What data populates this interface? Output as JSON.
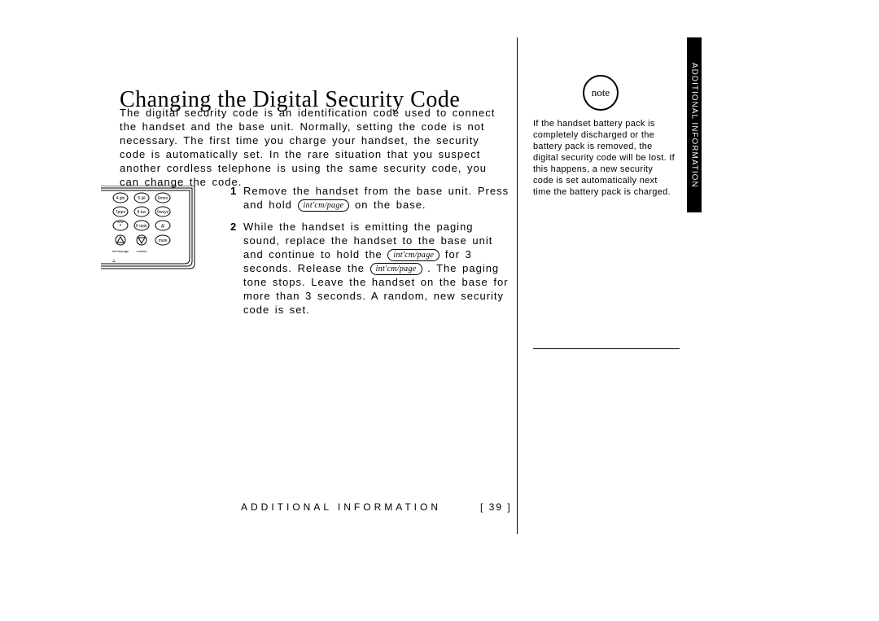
{
  "title": "Changing the Digital Security Code",
  "intro": "The digital security code is an identification code used to connect the handset and the base unit. Normally, setting the code is not necessary. The first time you charge your handset, the security code is automatically set. In the rare situation that you suspect another cordless telephone is using the same security code, you can change the code.",
  "steps": [
    {
      "num": "1",
      "parts": [
        {
          "t": "text",
          "v": "Remove the handset from the base unit. Press and hold "
        },
        {
          "t": "pill",
          "v": "int'cm/page"
        },
        {
          "t": "text",
          "v": " on the base."
        }
      ]
    },
    {
      "num": "2",
      "parts": [
        {
          "t": "text",
          "v": "While the handset is emitting the paging sound, replace the handset to the base unit and continue to hold the "
        },
        {
          "t": "pill",
          "v": "int'cm/page"
        },
        {
          "t": "text",
          "v": " for 3 seconds. Release the "
        },
        {
          "t": "pill",
          "v": "int'cm/page"
        },
        {
          "t": "text",
          "v": " . The paging tone stops. Leave the handset on the base for more than 3 seconds. A random, new security code is set."
        }
      ]
    }
  ],
  "note_label": "note",
  "note_text": "If the handset battery pack is completely discharged or the battery pack is removed, the digital security code will be lost. If this happens, a new security code is set automatically next time the battery pack is charged.",
  "side_tab": "ADDITIONAL INFORMATION",
  "footer_section": "ADDITIONAL INFORMATION",
  "footer_page": "[ 39 ]",
  "keypad": {
    "row1": [
      "4 ghi",
      "5 jkl",
      "6 mno"
    ],
    "row2": [
      "7 pqrs",
      "8 tuv",
      "9 wxyz"
    ],
    "row3": [
      "*",
      "0 oper",
      "#"
    ],
    "row4_icons": [
      "up",
      "down",
      "mute"
    ],
    "bottom_labels": [
      "int'cm/page",
      "volume"
    ]
  }
}
